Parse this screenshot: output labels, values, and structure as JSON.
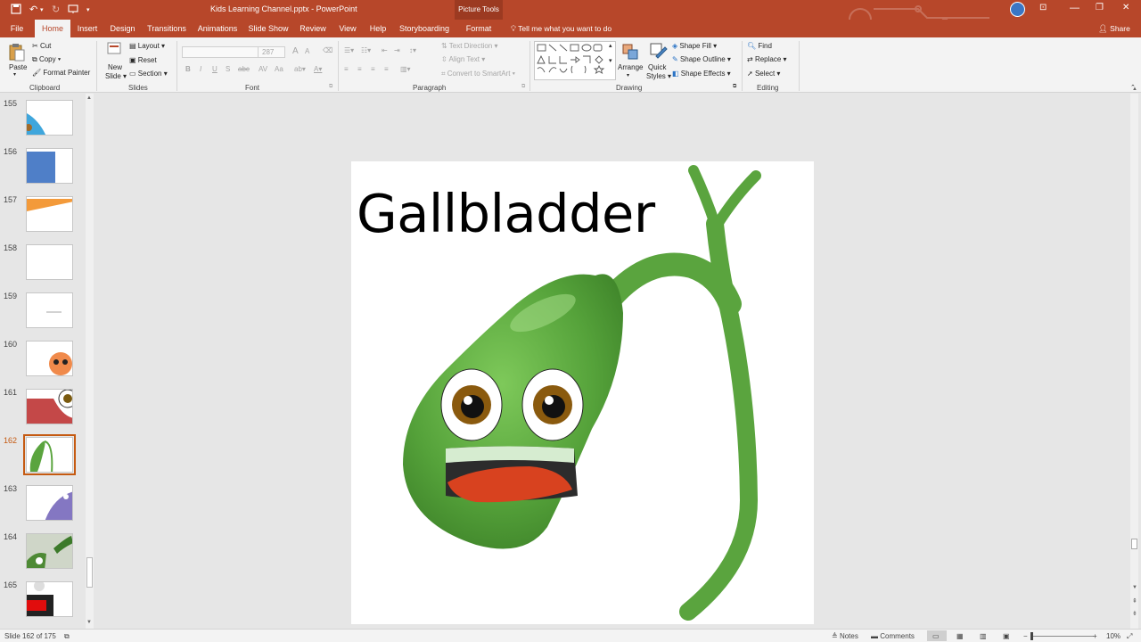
{
  "titlebar": {
    "title": "Kids Learning Channel.pptx - PowerPoint",
    "context_group": "Picture Tools",
    "min": "—",
    "restore": "❐",
    "close": "✕"
  },
  "tabs": [
    "File",
    "Home",
    "Insert",
    "Design",
    "Transitions",
    "Animations",
    "Slide Show",
    "Review",
    "View",
    "Help",
    "Storyboarding",
    "Format"
  ],
  "tellme": "Tell me what you want to do",
  "share": "Share",
  "ribbon": {
    "clipboard": {
      "paste": "Paste",
      "cut": "Cut",
      "copy": "Copy",
      "format_painter": "Format Painter",
      "label": "Clipboard"
    },
    "slides": {
      "new_slide_1": "New",
      "new_slide_2": "Slide",
      "layout": "Layout",
      "reset": "Reset",
      "section": "Section",
      "label": "Slides"
    },
    "font": {
      "size": "287",
      "label": "Font"
    },
    "paragraph": {
      "text_direction": "Text Direction",
      "align_text": "Align Text",
      "smartart": "Convert to SmartArt",
      "label": "Paragraph"
    },
    "drawing": {
      "arrange": "Arrange",
      "quick_styles_1": "Quick",
      "quick_styles_2": "Styles",
      "shape_fill": "Shape Fill",
      "shape_outline": "Shape Outline",
      "shape_effects": "Shape Effects",
      "label": "Drawing"
    },
    "editing": {
      "find": "Find",
      "replace": "Replace",
      "select": "Select",
      "label": "Editing"
    }
  },
  "thumbnails": [
    "155",
    "156",
    "157",
    "158",
    "159",
    "160",
    "161",
    "162",
    "163",
    "164",
    "165"
  ],
  "selected_slide": "162",
  "slide": {
    "title": "Gallbladder"
  },
  "status": {
    "slide_count": "Slide 162 of 175",
    "notes": "Notes",
    "comments": "Comments",
    "zoom": "10%"
  },
  "colors": {
    "accent": "#b7472a",
    "selected_thumb": "#c55a11",
    "gallbladder_green": "#5aa43e"
  }
}
